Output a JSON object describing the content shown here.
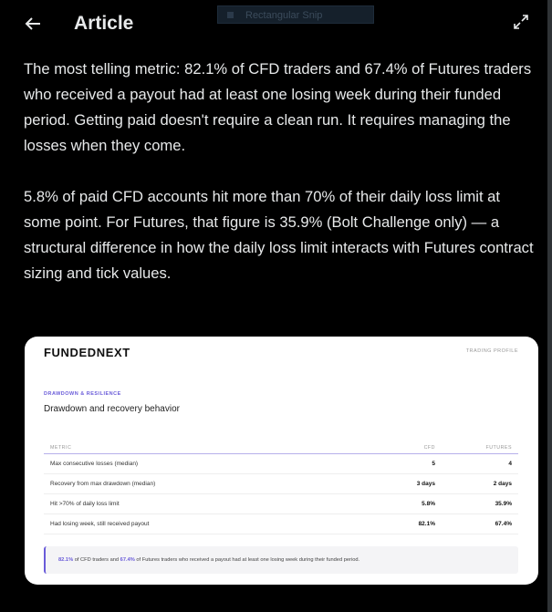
{
  "header": {
    "title": "Article",
    "back_icon": "back-arrow-icon",
    "expand_icon": "expand-icon"
  },
  "overlay": {
    "label": "Rectangular Snip"
  },
  "article": {
    "paragraphs": [
      "The most telling metric: 82.1% of CFD traders and 67.4% of Futures traders who received a payout had at least one losing week during their funded period. Getting paid doesn't require a clean run. It requires managing the losses when they come.",
      "5.8% of paid CFD accounts hit more than 70% of their daily loss limit at some point. For Futures, that figure is 35.9% (Bolt Challenge only) — a structural difference in how the daily loss limit interacts with Futures contract sizing and tick values."
    ]
  },
  "card": {
    "logo": "FUNDEDNEXT",
    "profile_tag": "TRADING PROFILE",
    "section_tag": "DRAWDOWN & RESILIENCE",
    "title": "Drawdown and recovery behavior",
    "table": {
      "headers": [
        "METRIC",
        "CFD",
        "FUTURES"
      ],
      "rows": [
        [
          "Max consecutive losses (median)",
          "5",
          "4"
        ],
        [
          "Recovery from max drawdown (median)",
          "3 days",
          "2 days"
        ],
        [
          "Hit >70% of daily loss limit",
          "5.8%",
          "35.9%"
        ],
        [
          "Had losing week, still received payout",
          "82.1%",
          "67.4%"
        ]
      ]
    },
    "callout": {
      "hl1": "82.1%",
      "t1": " of CFD traders and ",
      "hl2": "67.4%",
      "t2": " of Futures traders who received a payout had at least one losing week during their funded period."
    },
    "accent_color": "#6a5cd9"
  }
}
